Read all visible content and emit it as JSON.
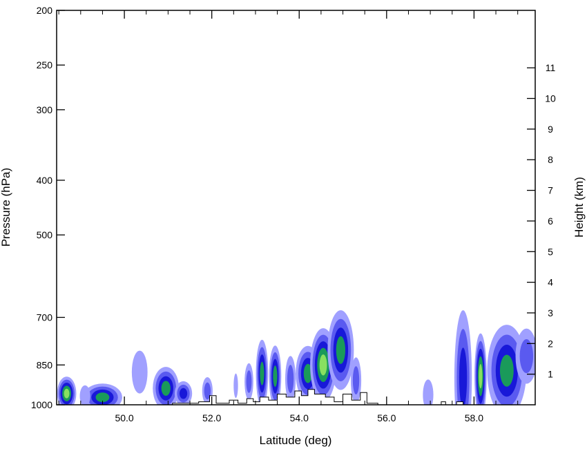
{
  "chart_data": {
    "type": "heatmap",
    "title": "",
    "xlabel": "Latitude (deg)",
    "ylabel": "Pressure (hPa)",
    "y2label": "Height (km)",
    "xlim": [
      48.45,
      59.4
    ],
    "ylim": [
      1000,
      200
    ],
    "y_scale": "log",
    "y2lim_km": [
      0,
      11.9
    ],
    "x_ticks": [
      "50.0",
      "52.0",
      "54.0",
      "56.0",
      "58.0"
    ],
    "x_tick_values": [
      50,
      52,
      54,
      56,
      58
    ],
    "y_ticks": [
      "200",
      "250",
      "300",
      "400",
      "500",
      "700",
      "850",
      "1000"
    ],
    "y_tick_values": [
      200,
      250,
      300,
      400,
      500,
      700,
      850,
      1000
    ],
    "y2_ticks": [
      "1",
      "2",
      "3",
      "4",
      "5",
      "6",
      "7",
      "8",
      "9",
      "10",
      "11"
    ],
    "y2_tick_values": [
      1,
      2,
      3,
      4,
      5,
      6,
      7,
      8,
      9,
      10,
      11
    ],
    "grid": false,
    "legend": "none",
    "colors": [
      "#a0a0ff",
      "#5a5af0",
      "#1818d8",
      "#1a9a5a",
      "#88e060"
    ],
    "echo_cells": [
      {
        "lat": 48.68,
        "p": 955,
        "dlat": 0.22,
        "dz": 0.55,
        "level": 5
      },
      {
        "lat": 49.5,
        "p": 970,
        "dlat": 0.45,
        "dz": 0.45,
        "level": 4
      },
      {
        "lat": 49.1,
        "p": 965,
        "dlat": 0.12,
        "dz": 0.35,
        "level": 1
      },
      {
        "lat": 50.35,
        "p": 875,
        "dlat": 0.18,
        "dz": 0.7,
        "level": 1
      },
      {
        "lat": 50.95,
        "p": 935,
        "dlat": 0.3,
        "dz": 0.7,
        "level": 4
      },
      {
        "lat": 51.35,
        "p": 955,
        "dlat": 0.2,
        "dz": 0.4,
        "level": 3
      },
      {
        "lat": 51.9,
        "p": 945,
        "dlat": 0.12,
        "dz": 0.45,
        "level": 2
      },
      {
        "lat": 52.55,
        "p": 925,
        "dlat": 0.05,
        "dz": 0.4,
        "level": 1
      },
      {
        "lat": 52.85,
        "p": 910,
        "dlat": 0.1,
        "dz": 0.6,
        "level": 2
      },
      {
        "lat": 53.15,
        "p": 880,
        "dlat": 0.14,
        "dz": 1.1,
        "level": 4
      },
      {
        "lat": 53.45,
        "p": 890,
        "dlat": 0.14,
        "dz": 1.0,
        "level": 4
      },
      {
        "lat": 53.8,
        "p": 900,
        "dlat": 0.12,
        "dz": 0.75,
        "level": 2
      },
      {
        "lat": 54.2,
        "p": 880,
        "dlat": 0.28,
        "dz": 0.9,
        "level": 4
      },
      {
        "lat": 54.55,
        "p": 850,
        "dlat": 0.3,
        "dz": 1.2,
        "level": 5
      },
      {
        "lat": 54.95,
        "p": 800,
        "dlat": 0.3,
        "dz": 1.3,
        "level": 4
      },
      {
        "lat": 55.3,
        "p": 905,
        "dlat": 0.12,
        "dz": 0.75,
        "level": 2
      },
      {
        "lat": 56.95,
        "p": 960,
        "dlat": 0.12,
        "dz": 0.5,
        "level": 1
      },
      {
        "lat": 57.75,
        "p": 895,
        "dlat": 0.2,
        "dz": 2.2,
        "level": 3
      },
      {
        "lat": 58.15,
        "p": 890,
        "dlat": 0.14,
        "dz": 1.4,
        "level": 5
      },
      {
        "lat": 58.75,
        "p": 870,
        "dlat": 0.45,
        "dz": 1.5,
        "level": 4
      },
      {
        "lat": 59.2,
        "p": 820,
        "dlat": 0.25,
        "dz": 0.9,
        "level": 2
      }
    ],
    "terrain_km": [
      [
        48.45,
        0
      ],
      [
        51.1,
        0
      ],
      [
        51.1,
        0.05
      ],
      [
        51.7,
        0.05
      ],
      [
        51.7,
        0.1
      ],
      [
        51.95,
        0.1
      ],
      [
        51.95,
        0.3
      ],
      [
        52.1,
        0.3
      ],
      [
        52.1,
        0.05
      ],
      [
        52.4,
        0.05
      ],
      [
        52.4,
        0.15
      ],
      [
        52.6,
        0.15
      ],
      [
        52.6,
        0.05
      ],
      [
        52.8,
        0.05
      ],
      [
        52.8,
        0.2
      ],
      [
        52.95,
        0.2
      ],
      [
        52.95,
        0.1
      ],
      [
        53.1,
        0.1
      ],
      [
        53.1,
        0.25
      ],
      [
        53.3,
        0.25
      ],
      [
        53.3,
        0.15
      ],
      [
        53.5,
        0.15
      ],
      [
        53.5,
        0.35
      ],
      [
        53.7,
        0.35
      ],
      [
        53.7,
        0.25
      ],
      [
        53.9,
        0.25
      ],
      [
        53.9,
        0.45
      ],
      [
        54.05,
        0.45
      ],
      [
        54.05,
        0.3
      ],
      [
        54.2,
        0.3
      ],
      [
        54.2,
        0.5
      ],
      [
        54.35,
        0.5
      ],
      [
        54.35,
        0.35
      ],
      [
        54.6,
        0.35
      ],
      [
        54.6,
        0.25
      ],
      [
        54.8,
        0.25
      ],
      [
        54.8,
        0.1
      ],
      [
        55.0,
        0.1
      ],
      [
        55.0,
        0.35
      ],
      [
        55.2,
        0.35
      ],
      [
        55.2,
        0.15
      ],
      [
        55.4,
        0.15
      ],
      [
        55.4,
        0.4
      ],
      [
        55.55,
        0.4
      ],
      [
        55.55,
        0.05
      ],
      [
        55.8,
        0.05
      ],
      [
        55.8,
        0
      ],
      [
        57.25,
        0
      ],
      [
        57.25,
        0.1
      ],
      [
        57.35,
        0.1
      ],
      [
        57.35,
        0
      ],
      [
        57.6,
        0
      ],
      [
        57.6,
        0.1
      ],
      [
        57.75,
        0.1
      ],
      [
        57.75,
        0
      ],
      [
        59.4,
        0
      ]
    ]
  }
}
